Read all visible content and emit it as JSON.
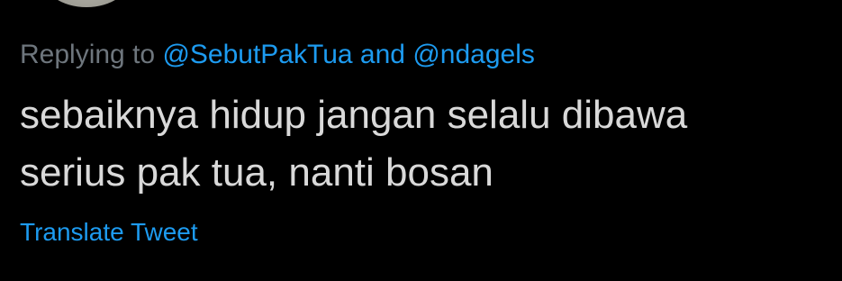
{
  "reply": {
    "prefix": "Replying to",
    "mention_1": "@SebutPakTua",
    "conjunction": "and",
    "mention_2": "@ndagels"
  },
  "tweet": {
    "text_line_1": "sebaiknya hidup jangan selalu dibawa",
    "text_line_2": "serius pak tua, nanti bosan"
  },
  "translate_label": "Translate Tweet",
  "colors": {
    "background": "#000000",
    "text": "#d9d9d9",
    "muted": "#6e767d",
    "accent": "#1d9bf0"
  }
}
